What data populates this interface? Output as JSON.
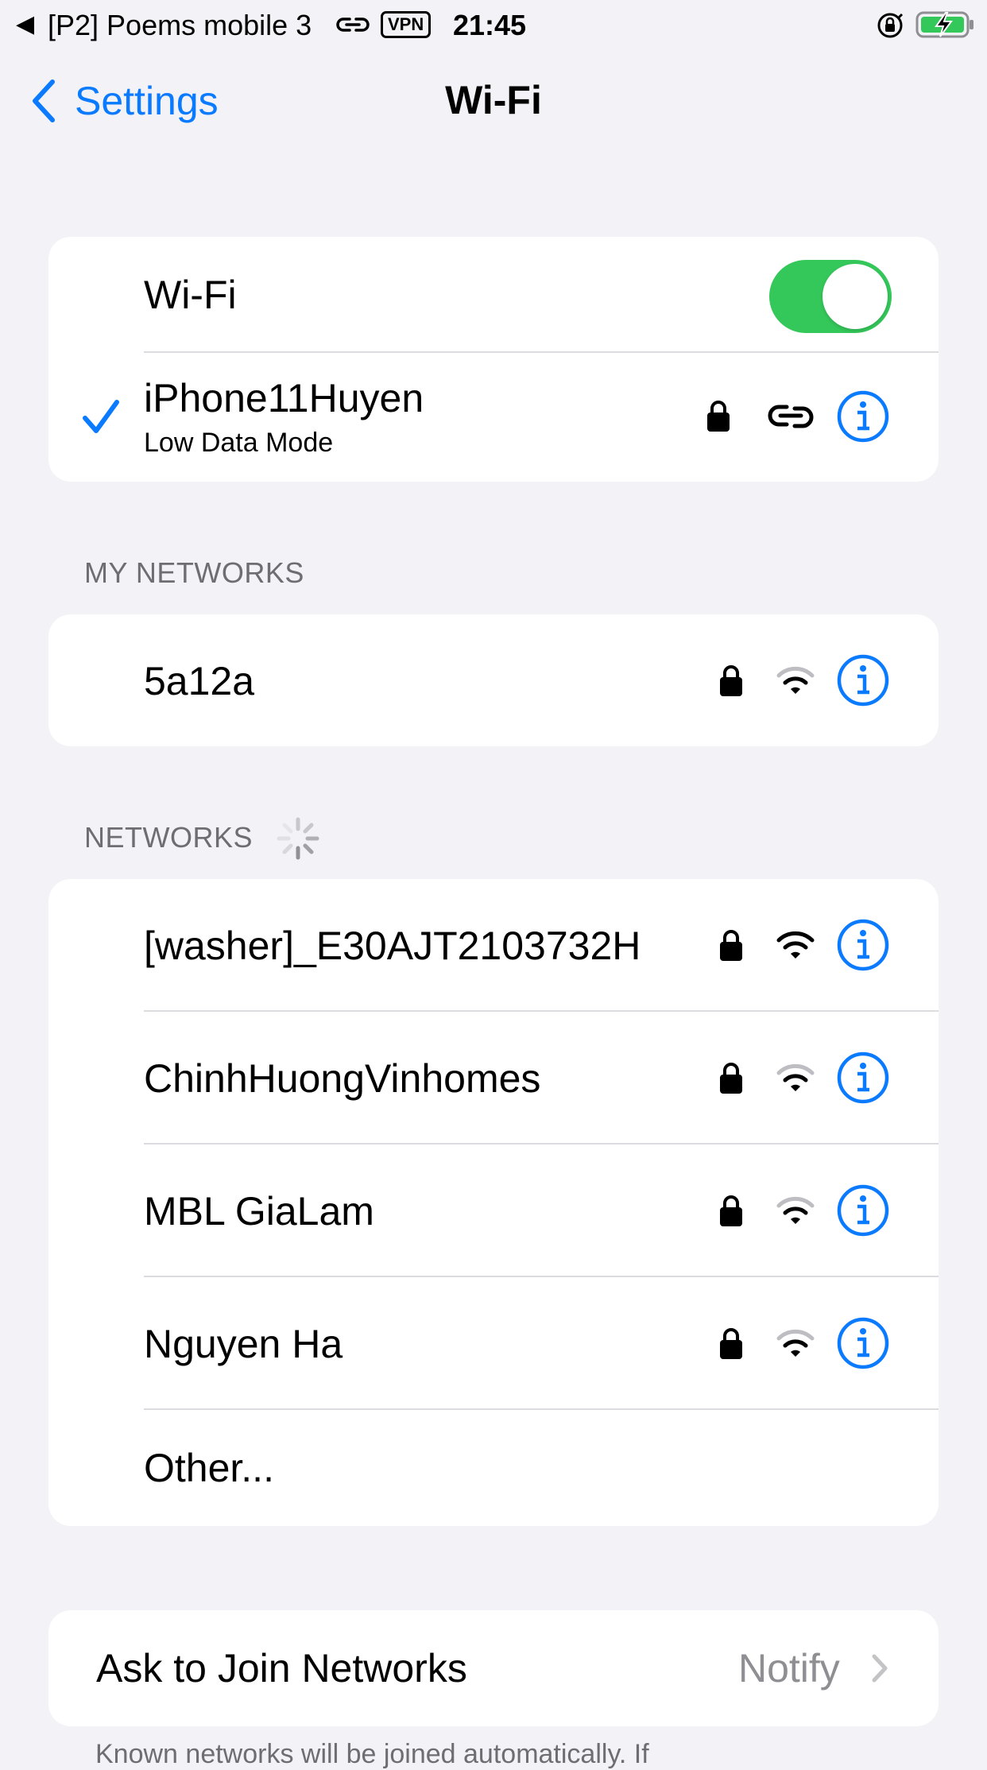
{
  "status_bar": {
    "back_glyph": "◀",
    "carrier": "[P2] Poems mobile 3",
    "vpn": "VPN",
    "time": "21:45",
    "icons": [
      "link-icon",
      "orientation-lock-icon",
      "battery-charging-icon"
    ]
  },
  "nav": {
    "back_label": "Settings",
    "title": "Wi-Fi"
  },
  "wifi_toggle": {
    "label": "Wi-Fi",
    "on": true
  },
  "connected_network": {
    "name": "iPhone11Huyen",
    "subtitle": "Low Data Mode",
    "icons": [
      "checkmark-icon",
      "lock-icon",
      "personal-hotspot-icon",
      "info-icon"
    ]
  },
  "my_networks": {
    "header": "MY NETWORKS",
    "items": [
      {
        "name": "5a12a",
        "secured": true,
        "signal": "medium"
      }
    ]
  },
  "networks": {
    "header": "NETWORKS",
    "items": [
      {
        "name": "[washer]_E30AJT2103732H",
        "secured": true,
        "signal": "full"
      },
      {
        "name": "ChinhHuongVinhomes",
        "secured": true,
        "signal": "medium"
      },
      {
        "name": "MBL GiaLam",
        "secured": true,
        "signal": "medium"
      },
      {
        "name": "Nguyen Ha",
        "secured": true,
        "signal": "medium"
      }
    ],
    "other_label": "Other..."
  },
  "ask_to_join": {
    "label": "Ask to Join Networks",
    "value": "Notify"
  },
  "footer": {
    "text": "Known networks will be joined automatically. If"
  },
  "colors": {
    "accent": "#0a7aff",
    "toggle_on": "#34c759",
    "background": "#f2f2f7",
    "secondary_text": "#6d6d72"
  }
}
